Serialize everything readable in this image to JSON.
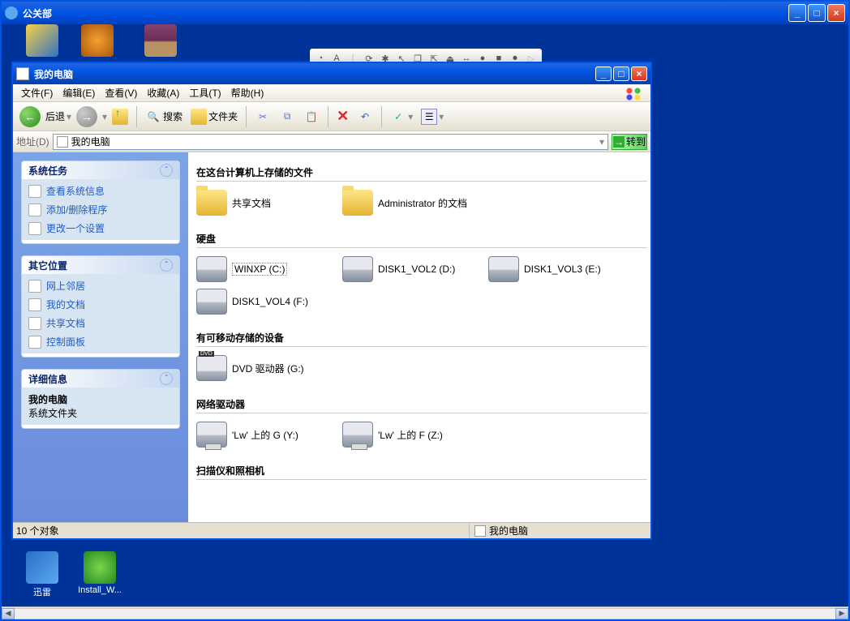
{
  "outer_window": {
    "title": "公关部"
  },
  "desktop_icons": {
    "xunlei": "迅雷",
    "install": "Install_W..."
  },
  "explorer": {
    "title": "我的电脑",
    "menubar": {
      "file": "文件(F)",
      "edit": "编辑(E)",
      "view": "查看(V)",
      "favorites": "收藏(A)",
      "tools": "工具(T)",
      "help": "帮助(H)"
    },
    "toolbar": {
      "back": "后退",
      "search": "搜索",
      "folders": "文件夹"
    },
    "addressbar": {
      "label": "地址(D)",
      "value": "我的电脑",
      "go": "转到"
    },
    "sidepanel": {
      "system_tasks": {
        "title": "系统任务",
        "links": {
          "view_sysinfo": "查看系统信息",
          "add_remove": "添加/删除程序",
          "change_setting": "更改一个设置"
        }
      },
      "other_places": {
        "title": "其它位置",
        "links": {
          "network": "网上邻居",
          "my_docs": "我的文档",
          "shared_docs": "共享文档",
          "control_panel": "控制面板"
        }
      },
      "details": {
        "title": "详细信息",
        "name": "我的电脑",
        "type": "系统文件夹"
      }
    },
    "content": {
      "group_files": "在这台计算机上存储的文件",
      "group_hdd": "硬盘",
      "group_removable": "有可移动存储的设备",
      "group_network": "网络驱动器",
      "group_scanners": "扫描仪和照相机",
      "items": {
        "shared_docs": "共享文档",
        "admin_docs": "Administrator 的文档",
        "drive_c": "WINXP (C:)",
        "drive_d": "DISK1_VOL2 (D:)",
        "drive_e": "DISK1_VOL3 (E:)",
        "drive_f": "DISK1_VOL4 (F:)",
        "dvd_g": "DVD 驱动器 (G:)",
        "net_y": "'Lw' 上的 G (Y:)",
        "net_z": "'Lw' 上的 F (Z:)"
      }
    },
    "statusbar": {
      "left": "10 个对象",
      "right": "我的电脑"
    }
  }
}
